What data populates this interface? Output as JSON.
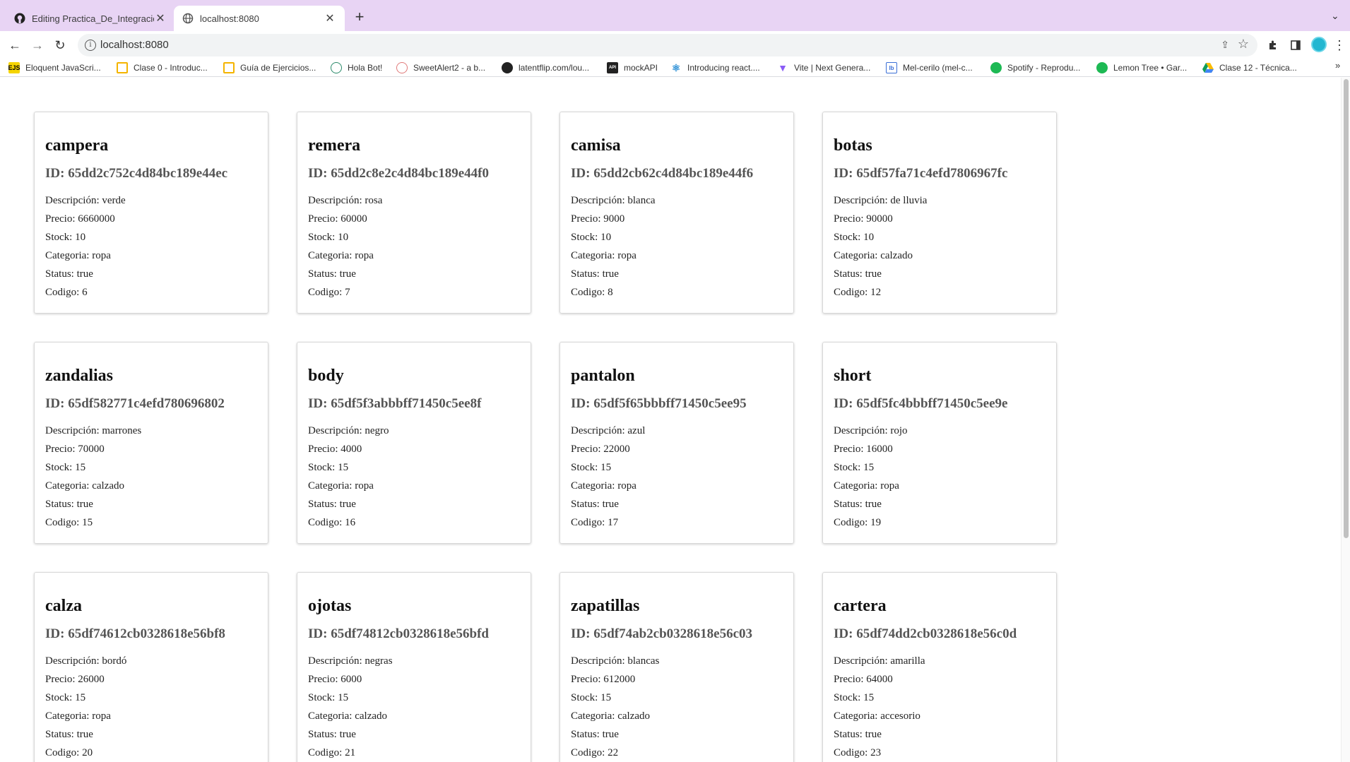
{
  "browser": {
    "tabs": [
      {
        "title": "Editing Practica_De_Integracio",
        "icon": "github-icon",
        "active": false
      },
      {
        "title": "localhost:8080",
        "icon": "globe-icon",
        "active": true
      }
    ],
    "url": "localhost:8080",
    "bookmarks": [
      {
        "label": "Eloquent JavaScri...",
        "icon": "ejs-icon"
      },
      {
        "label": "Clase 0 - Introduc...",
        "icon": "folder-icon"
      },
      {
        "label": "Guía de Ejercicios...",
        "icon": "folder-icon"
      },
      {
        "label": "Hola Bot!",
        "icon": "bot-icon"
      },
      {
        "label": "SweetAlert2 - a b...",
        "icon": "sweetalert-icon"
      },
      {
        "label": "latentflip.com/lou...",
        "icon": "latentflip-icon"
      },
      {
        "label": "mockAPI",
        "icon": "mockapi-icon"
      },
      {
        "label": "Introducing react....",
        "icon": "react-icon"
      },
      {
        "label": "Vite | Next Genera...",
        "icon": "vite-icon"
      },
      {
        "label": "Mel-cerilo (mel-c...",
        "icon": "mel-icon"
      },
      {
        "label": "Spotify - Reprodu...",
        "icon": "spotify-icon"
      },
      {
        "label": "Lemon Tree • Gar...",
        "icon": "spotify-icon"
      },
      {
        "label": "Clase 12 - Técnica...",
        "icon": "drive-icon"
      }
    ],
    "colors": {
      "tabstrip": "#e8d4f4",
      "avatar": "#23b7d1",
      "spotify": "#1db954"
    }
  },
  "labels": {
    "id": "ID: ",
    "descripcion": "Descripción: ",
    "precio": "Precio: ",
    "stock": "Stock: ",
    "categoria": "Categoria: ",
    "status": "Status: ",
    "codigo": "Codigo: "
  },
  "products": [
    {
      "name": "campera",
      "id": "65dd2c752c4d84bc189e44ec",
      "descripcion": "verde",
      "precio": "6660000",
      "stock": "10",
      "categoria": "ropa",
      "status": "true",
      "codigo": "6"
    },
    {
      "name": "remera",
      "id": "65dd2c8e2c4d84bc189e44f0",
      "descripcion": "rosa",
      "precio": "60000",
      "stock": "10",
      "categoria": "ropa",
      "status": "true",
      "codigo": "7"
    },
    {
      "name": "camisa",
      "id": "65dd2cb62c4d84bc189e44f6",
      "descripcion": "blanca",
      "precio": "9000",
      "stock": "10",
      "categoria": "ropa",
      "status": "true",
      "codigo": "8"
    },
    {
      "name": "botas",
      "id": "65df57fa71c4efd7806967fc",
      "descripcion": "de lluvia",
      "precio": "90000",
      "stock": "10",
      "categoria": "calzado",
      "status": "true",
      "codigo": "12"
    },
    {
      "name": "zandalias",
      "id": "65df582771c4efd780696802",
      "descripcion": "marrones",
      "precio": "70000",
      "stock": "15",
      "categoria": "calzado",
      "status": "true",
      "codigo": "15"
    },
    {
      "name": "body",
      "id": "65df5f3abbbff71450c5ee8f",
      "descripcion": "negro",
      "precio": "4000",
      "stock": "15",
      "categoria": "ropa",
      "status": "true",
      "codigo": "16"
    },
    {
      "name": "pantalon",
      "id": "65df5f65bbbff71450c5ee95",
      "descripcion": "azul",
      "precio": "22000",
      "stock": "15",
      "categoria": "ropa",
      "status": "true",
      "codigo": "17"
    },
    {
      "name": "short",
      "id": "65df5fc4bbbff71450c5ee9e",
      "descripcion": "rojo",
      "precio": "16000",
      "stock": "15",
      "categoria": "ropa",
      "status": "true",
      "codigo": "19"
    },
    {
      "name": "calza",
      "id": "65df74612cb0328618e56bf8",
      "descripcion": "bordó",
      "precio": "26000",
      "stock": "15",
      "categoria": "ropa",
      "status": "true",
      "codigo": "20"
    },
    {
      "name": "ojotas",
      "id": "65df74812cb0328618e56bfd",
      "descripcion": "negras",
      "precio": "6000",
      "stock": "15",
      "categoria": "calzado",
      "status": "true",
      "codigo": "21"
    },
    {
      "name": "zapatillas",
      "id": "65df74ab2cb0328618e56c03",
      "descripcion": "blancas",
      "precio": "612000",
      "stock": "15",
      "categoria": "calzado",
      "status": "true",
      "codigo": "22"
    },
    {
      "name": "cartera",
      "id": "65df74dd2cb0328618e56c0d",
      "descripcion": "amarilla",
      "precio": "64000",
      "stock": "15",
      "categoria": "accesorio",
      "status": "true",
      "codigo": "23"
    }
  ]
}
